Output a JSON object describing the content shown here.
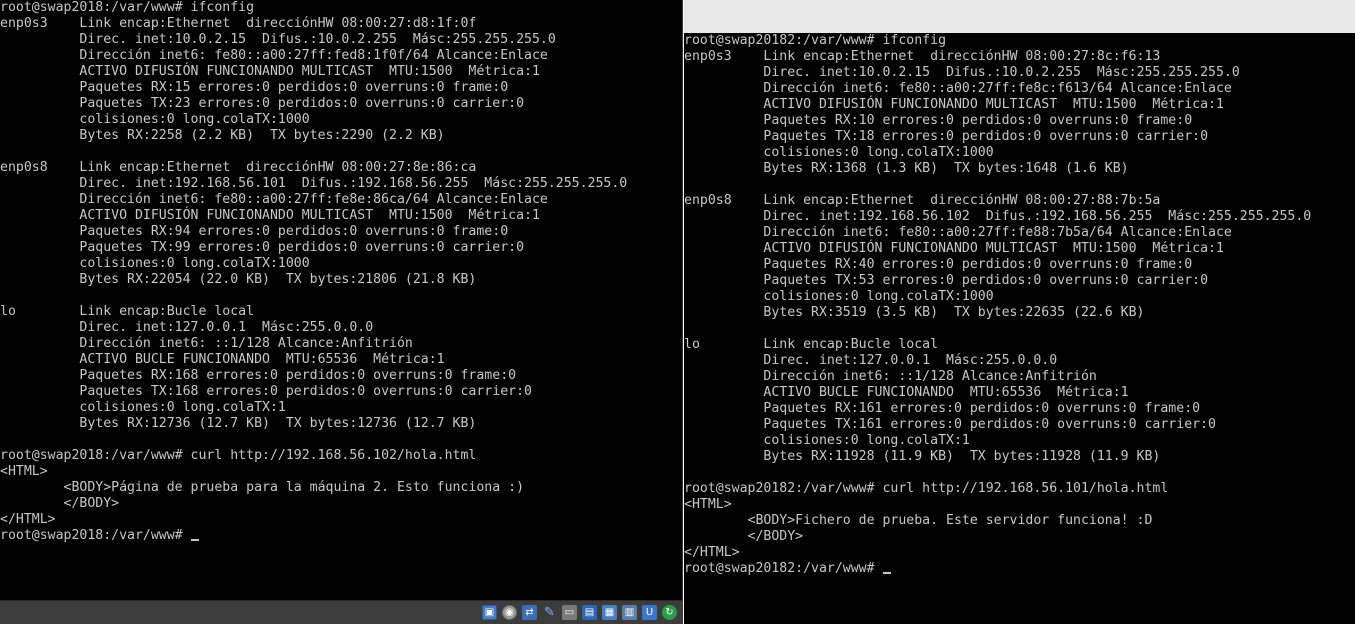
{
  "left_terminal": {
    "lines": [
      "root@swap2018:/var/www# ifconfig",
      "enp0s3    Link encap:Ethernet  direcciónHW 08:00:27:d8:1f:0f",
      "          Direc. inet:10.0.2.15  Difus.:10.0.2.255  Másc:255.255.255.0",
      "          Dirección inet6: fe80::a00:27ff:fed8:1f0f/64 Alcance:Enlace",
      "          ACTIVO DIFUSIÓN FUNCIONANDO MULTICAST  MTU:1500  Métrica:1",
      "          Paquetes RX:15 errores:0 perdidos:0 overruns:0 frame:0",
      "          Paquetes TX:23 errores:0 perdidos:0 overruns:0 carrier:0",
      "          colisiones:0 long.colaTX:1000",
      "          Bytes RX:2258 (2.2 KB)  TX bytes:2290 (2.2 KB)",
      "",
      "enp0s8    Link encap:Ethernet  direcciónHW 08:00:27:8e:86:ca",
      "          Direc. inet:192.168.56.101  Difus.:192.168.56.255  Másc:255.255.255.0",
      "          Dirección inet6: fe80::a00:27ff:fe8e:86ca/64 Alcance:Enlace",
      "          ACTIVO DIFUSIÓN FUNCIONANDO MULTICAST  MTU:1500  Métrica:1",
      "          Paquetes RX:94 errores:0 perdidos:0 overruns:0 frame:0",
      "          Paquetes TX:99 errores:0 perdidos:0 overruns:0 carrier:0",
      "          colisiones:0 long.colaTX:1000",
      "          Bytes RX:22054 (22.0 KB)  TX bytes:21806 (21.8 KB)",
      "",
      "lo        Link encap:Bucle local",
      "          Direc. inet:127.0.0.1  Másc:255.0.0.0",
      "          Dirección inet6: ::1/128 Alcance:Anfitrión",
      "          ACTIVO BUCLE FUNCIONANDO  MTU:65536  Métrica:1",
      "          Paquetes RX:168 errores:0 perdidos:0 overruns:0 frame:0",
      "          Paquetes TX:168 errores:0 perdidos:0 overruns:0 carrier:0",
      "          colisiones:0 long.colaTX:1",
      "          Bytes RX:12736 (12.7 KB)  TX bytes:12736 (12.7 KB)",
      "",
      "root@swap2018:/var/www# curl http://192.168.56.102/hola.html",
      "<HTML>",
      "        <BODY>Página de prueba para la máquina 2. Esto funciona :)",
      "        </BODY>",
      "</HTML>",
      "root@swap2018:/var/www# "
    ]
  },
  "right_terminal": {
    "lines": [
      "root@swap20182:/var/www# ifconfig",
      "enp0s3    Link encap:Ethernet  direcciónHW 08:00:27:8c:f6:13",
      "          Direc. inet:10.0.2.15  Difus.:10.0.2.255  Másc:255.255.255.0",
      "          Dirección inet6: fe80::a00:27ff:fe8c:f613/64 Alcance:Enlace",
      "          ACTIVO DIFUSIÓN FUNCIONANDO MULTICAST  MTU:1500  Métrica:1",
      "          Paquetes RX:10 errores:0 perdidos:0 overruns:0 frame:0",
      "          Paquetes TX:18 errores:0 perdidos:0 overruns:0 carrier:0",
      "          colisiones:0 long.colaTX:1000",
      "          Bytes RX:1368 (1.3 KB)  TX bytes:1648 (1.6 KB)",
      "",
      "enp0s8    Link encap:Ethernet  direcciónHW 08:00:27:88:7b:5a",
      "          Direc. inet:192.168.56.102  Difus.:192.168.56.255  Másc:255.255.255.0",
      "          Dirección inet6: fe80::a00:27ff:fe88:7b5a/64 Alcance:Enlace",
      "          ACTIVO DIFUSIÓN FUNCIONANDO MULTICAST  MTU:1500  Métrica:1",
      "          Paquetes RX:40 errores:0 perdidos:0 overruns:0 frame:0",
      "          Paquetes TX:53 errores:0 perdidos:0 overruns:0 carrier:0",
      "          colisiones:0 long.colaTX:1000",
      "          Bytes RX:3519 (3.5 KB)  TX bytes:22635 (22.6 KB)",
      "",
      "lo        Link encap:Bucle local",
      "          Direc. inet:127.0.0.1  Másc:255.0.0.0",
      "          Dirección inet6: ::1/128 Alcance:Anfitrión",
      "          ACTIVO BUCLE FUNCIONANDO  MTU:65536  Métrica:1",
      "          Paquetes RX:161 errores:0 perdidos:0 overruns:0 frame:0",
      "          Paquetes TX:161 errores:0 perdidos:0 overruns:0 carrier:0",
      "          colisiones:0 long.colaTX:1",
      "          Bytes RX:11928 (11.9 KB)  TX bytes:11928 (11.9 KB)",
      "",
      "root@swap20182:/var/www# curl http://192.168.56.101/hola.html",
      "<HTML>",
      "        <BODY>Fichero de prueba. Este servidor funciona! :D",
      "        </BODY>",
      "</HTML>",
      "root@swap20182:/var/www# "
    ]
  },
  "statusbar": {
    "icons": [
      {
        "name": "hard-disk-icon",
        "glyph": "▣"
      },
      {
        "name": "optical-drive-icon",
        "glyph": "◉"
      },
      {
        "name": "network-icon",
        "glyph": "⇄"
      },
      {
        "name": "usb-icon",
        "glyph": "✎"
      },
      {
        "name": "shared-folders-icon",
        "glyph": "▭"
      },
      {
        "name": "display-icon",
        "glyph": "▤"
      },
      {
        "name": "video-capture-icon",
        "glyph": "▦"
      },
      {
        "name": "cpu-icon",
        "glyph": "▥"
      },
      {
        "name": "mouse-integration-icon",
        "glyph": "U"
      },
      {
        "name": "host-key-icon",
        "glyph": "↻"
      }
    ]
  },
  "colors": {
    "terminal_bg": "#000000",
    "terminal_fg": "#c8c8c8",
    "statusbar_bg": "#3c3c3c"
  }
}
